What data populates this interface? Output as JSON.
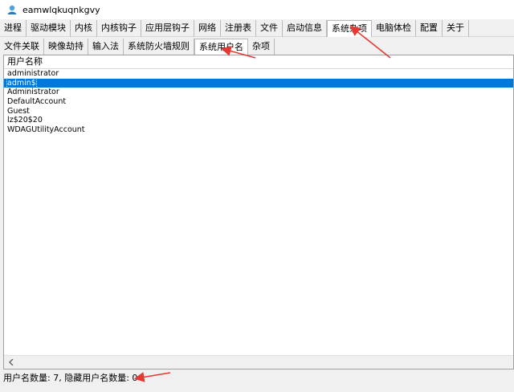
{
  "window": {
    "title": "eamwlqkuqnkgvy",
    "icon": "app-icon"
  },
  "main_tabs": [
    {
      "label": "进程"
    },
    {
      "label": "驱动模块"
    },
    {
      "label": "内核"
    },
    {
      "label": "内核钩子"
    },
    {
      "label": "应用层钩子"
    },
    {
      "label": "网络"
    },
    {
      "label": "注册表"
    },
    {
      "label": "文件"
    },
    {
      "label": "启动信息"
    },
    {
      "label": "系统杂项",
      "active": true
    },
    {
      "label": "电脑体检"
    },
    {
      "label": "配置"
    },
    {
      "label": "关于"
    }
  ],
  "sub_tabs": [
    {
      "label": "文件关联"
    },
    {
      "label": "映像劫持"
    },
    {
      "label": "输入法"
    },
    {
      "label": "系统防火墙规则"
    },
    {
      "label": "系统用户名",
      "active": true
    },
    {
      "label": "杂项"
    }
  ],
  "list": {
    "column_header": "用户名称",
    "rows": [
      "administrator",
      "admin$",
      "Administrator",
      "DefaultAccount",
      "Guest",
      "lz$20$20",
      "WDAGUtilityAccount"
    ],
    "selected_index": 1
  },
  "status_bar": {
    "text": "用户名数量: 7, 隐藏用户名数量: 0"
  },
  "colors": {
    "selection": "#0078d7",
    "annotation_arrow": "#e53935"
  }
}
